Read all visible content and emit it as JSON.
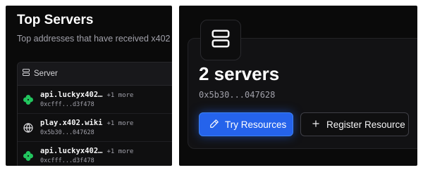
{
  "left_panel": {
    "title": "Top Servers",
    "subtitle": "Top addresses that have received x402",
    "table": {
      "header_label": "Server",
      "rows": [
        {
          "icon": "clover-icon",
          "domain": "api.luckyx402…",
          "more": "+1 more",
          "address": "0xcfff...d3f478"
        },
        {
          "icon": "globe-icon",
          "domain": "play.x402.wiki",
          "more": "+1 more",
          "address": "0x5b30...047628"
        },
        {
          "icon": "clover-icon",
          "domain": "api.luckyx402…",
          "more": "+1 more",
          "address": "0xcfff...d3f478"
        }
      ]
    }
  },
  "right_panel": {
    "server_count": "2 servers",
    "address": "0x5b30...047628",
    "try_button_label": "Try Resources",
    "register_button_label": "Register Resource"
  },
  "colors": {
    "background": "#0a0a0a",
    "accent": "#2563eb",
    "clover": "#22c55e",
    "muted_text": "#a1a1aa"
  }
}
